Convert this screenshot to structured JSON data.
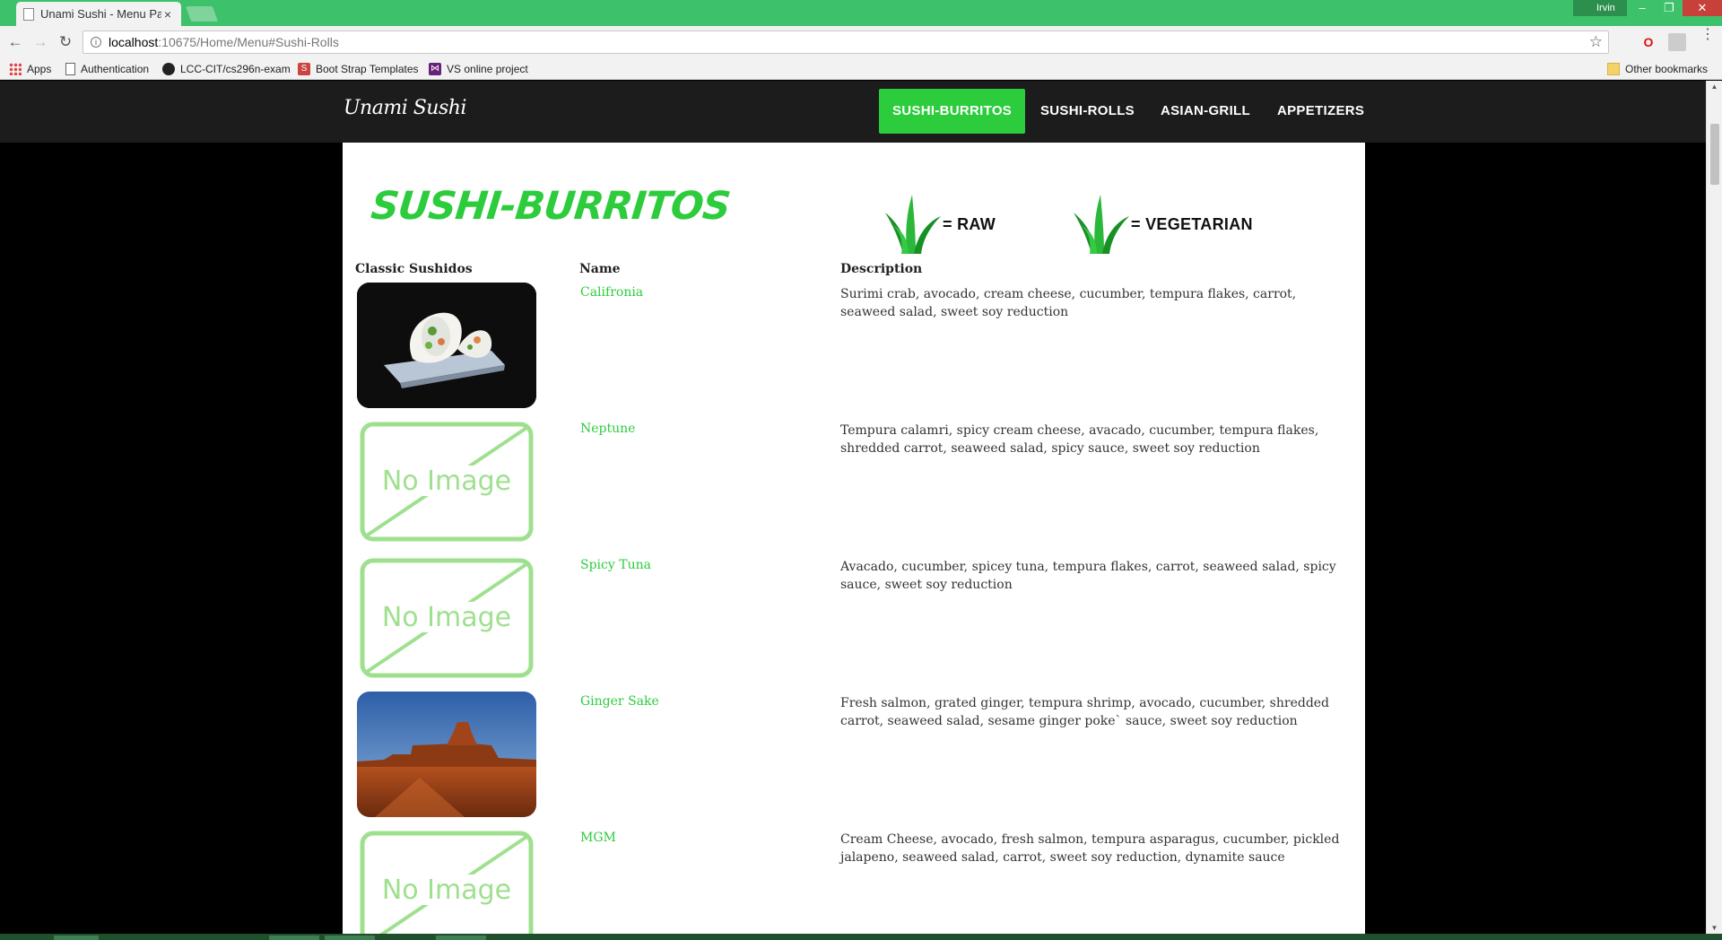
{
  "browser": {
    "tab_title": "Unami Sushi - Menu Pag",
    "tab_close": "×",
    "user_name": "Irvin",
    "window_controls": {
      "minimize": "–",
      "restore": "❐",
      "close": "✕"
    },
    "url_host": "localhost",
    "url_path": ":10675/Home/Menu#Sushi-Rolls",
    "back_icon": "←",
    "forward_icon": "→",
    "reload_icon": "↻",
    "star_icon": "☆",
    "bookmarks": [
      {
        "label": "Apps",
        "icon": "apps-icon"
      },
      {
        "label": "Authentication",
        "icon": "page-icon"
      },
      {
        "label": "LCC-CIT/cs296n-exam",
        "icon": "github-icon"
      },
      {
        "label": "Boot Strap Templates",
        "icon": "bootstrap-icon"
      },
      {
        "label": "VS online project",
        "icon": "visual-studio-icon"
      }
    ],
    "other_bookmarks": "Other bookmarks",
    "bootstrap_glyph": "S",
    "vs_glyph": "⋈"
  },
  "site": {
    "brand": "Unami Sushi",
    "nav": [
      {
        "label": "SUSHI-BURRITOS",
        "active": true
      },
      {
        "label": "SUSHI-ROLLS",
        "active": false
      },
      {
        "label": "ASIAN-GRILL",
        "active": false
      },
      {
        "label": "APPETIZERS",
        "active": false
      }
    ],
    "accent_color": "#2ccc3c"
  },
  "menu": {
    "heading": "SUSHI-BURRITOS",
    "legend_raw": "= RAW",
    "legend_veg": "= VEGETARIAN",
    "col_image": "Classic Sushidos",
    "col_name": "Name",
    "col_desc": "Description",
    "no_image_text": "No Image",
    "items": [
      {
        "name": "Califronia",
        "image": "sushi-burrito-photo",
        "description": "Surimi crab, avocado, cream cheese, cucumber, tempura flakes, carrot, seaweed salad, sweet soy reduction"
      },
      {
        "name": "Neptune",
        "image": "no-image",
        "description": "Tempura calamri, spicy cream cheese, avacado, cucumber, tempura flakes, shredded carrot, seaweed salad, spicy sauce, sweet soy reduction"
      },
      {
        "name": "Spicy Tuna",
        "image": "no-image",
        "description": "Avacado, cucumber, spicey tuna, tempura flakes, carrot, seaweed salad, spicy sauce, sweet soy reduction"
      },
      {
        "name": "Ginger Sake",
        "image": "desert-mesa-photo",
        "description": "Fresh salmon, grated ginger, tempura shrimp, avocado, cucumber, shredded carrot, seaweed salad, sesame ginger poke` sauce, sweet soy reduction"
      },
      {
        "name": "MGM",
        "image": "no-image",
        "description": "Cream Cheese, avocado, fresh salmon, tempura asparagus, cucumber, pickled jalapeno, seaweed salad, carrot, sweet soy reduction, dynamite sauce"
      }
    ]
  }
}
